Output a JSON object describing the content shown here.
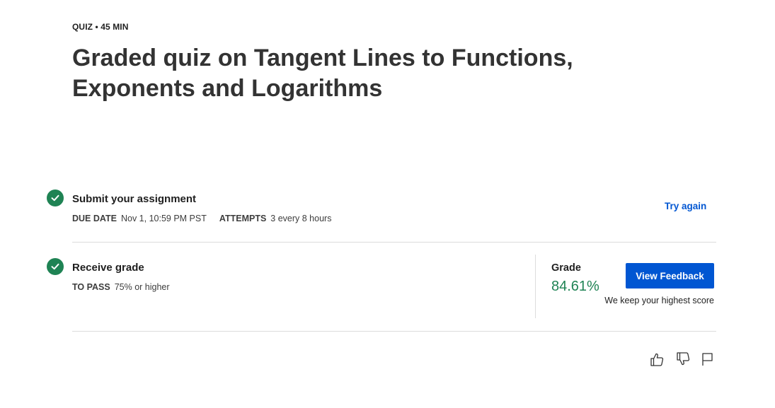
{
  "header": {
    "meta": "QUIZ • 45 MIN",
    "title": "Graded quiz on Tangent Lines to Functions, Exponents and Logarithms"
  },
  "submit_step": {
    "title": "Submit your assignment",
    "due_label": "DUE DATE",
    "due_value": "Nov 1, 10:59 PM PST",
    "attempts_label": "ATTEMPTS",
    "attempts_value": "3 every 8 hours",
    "action_label": "Try again",
    "completed": true
  },
  "grade_step": {
    "title": "Receive grade",
    "pass_label": "TO PASS",
    "pass_value": "75% or higher",
    "completed": true
  },
  "grade_panel": {
    "label": "Grade",
    "value": "84.61%",
    "button_label": "View Feedback",
    "note": "We keep your highest score"
  },
  "feedback_icons": [
    "thumbs-up-icon",
    "thumbs-down-icon",
    "flag-icon"
  ],
  "colors": {
    "accent": "#0056d2",
    "success": "#1f8354",
    "text": "#1f1f1f",
    "divider": "#dcdcdc"
  }
}
